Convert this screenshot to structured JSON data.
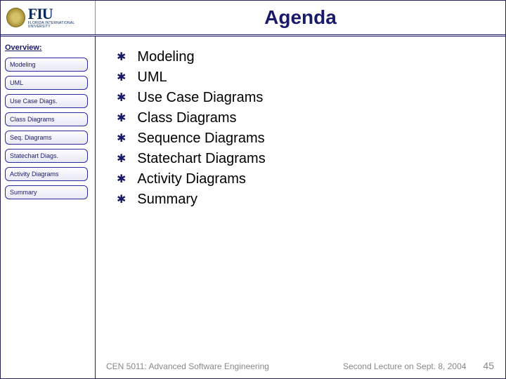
{
  "header": {
    "logo": {
      "big": "FIU",
      "small": "FLORIDA INTERNATIONAL UNIVERSITY"
    },
    "title": "Agenda"
  },
  "sidebar": {
    "heading": "Overview:",
    "items": [
      {
        "label": "Modeling"
      },
      {
        "label": "UML"
      },
      {
        "label": "Use Case Diags."
      },
      {
        "label": "Class Diagrams"
      },
      {
        "label": "Seq. Diagrams"
      },
      {
        "label": "Statechart Diags."
      },
      {
        "label": "Activity Diagrams"
      },
      {
        "label": "Summary"
      }
    ]
  },
  "agenda": {
    "items": [
      "Modeling",
      "UML",
      "Use Case Diagrams",
      "Class Diagrams",
      "Sequence Diagrams",
      "Statechart Diagrams",
      "Activity Diagrams",
      "Summary"
    ]
  },
  "footer": {
    "course": "CEN 5011: Advanced Software Engineering",
    "lecture": "Second Lecture on Sept. 8, 2004",
    "page": "45"
  }
}
